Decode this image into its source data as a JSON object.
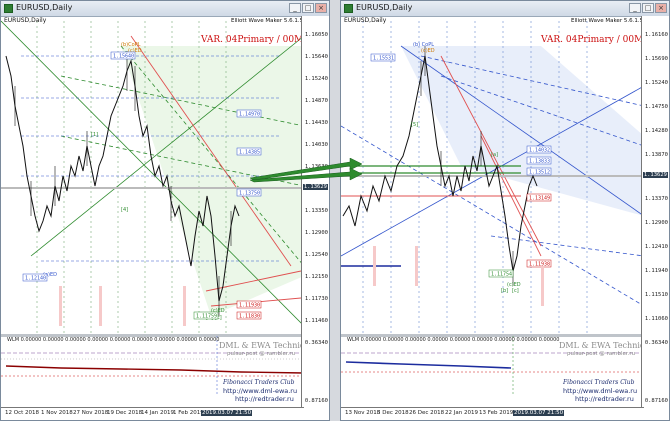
{
  "left": {
    "title": "EURUSD,Daily",
    "chart_label": "EURUSD,Daily",
    "tool": "Elliott Wave Maker 5.6.1.5",
    "variant": "VAR. 04Primary / 00Minute",
    "price_labels": [
      "1.16050",
      "1.15640",
      "1.15240",
      "1.14870",
      "1.14430",
      "1.14030",
      "1.13630",
      "1.13350",
      "1.12900",
      "1.12540",
      "1.12150",
      "1.11730",
      "1.11460"
    ],
    "current_price": "1.13629",
    "price_boxes": [
      "1.15640",
      "1.14970",
      "1.14385",
      "1.13750",
      "1.12140",
      "1.11759",
      "1.11930",
      "1.11830"
    ],
    "dates": [
      "12 Oct 2018",
      "1 Nov 2018",
      "27 Nov 2018",
      "19 Dec 2018",
      "14 Jan 2019",
      "1 Feb 2019"
    ],
    "current_date": "2019.03.07 21:50",
    "indicator_label": "WLM 0.00000 0.00000 0.00000 0.00000 0.00000 0.00000 0.00000 0.00000 0.00000",
    "indicator_right": "0.36340",
    "indicator_bottom": "0.87160",
    "brand": "DML & EWA Technique",
    "brand_sub": "pulsar-post @ rambler.ru",
    "fib": "Fibonacci  Traders  Club",
    "url1": "http://www.dml-ewa.ru",
    "url2": "http://redtrader.ru",
    "wave_labels": [
      "(b)CoPL",
      "(c)ED",
      "[a]",
      "(a)ED",
      "(c)ED",
      "[b]",
      "[c]"
    ]
  },
  "right": {
    "title": "EURUSD,Daily",
    "chart_label": "EURUSD,Daily",
    "tool": "Elliott Wave Maker 5.6.1.5",
    "variant": "VAR. 04Primary / 00Minute",
    "price_labels": [
      "1.16160",
      "1.15690",
      "1.15240",
      "1.14750",
      "1.14280",
      "1.13870",
      "1.13370",
      "1.12900",
      "1.12410",
      "1.11940",
      "1.11510",
      "1.11060"
    ],
    "current_price": "1.13629",
    "price_boxes": [
      "1.15531",
      "1.14032",
      "1.13833",
      "1.13512",
      "1.13149",
      "1.11938",
      "1.11754"
    ],
    "dates": [
      "13 Nov 2018",
      "5 Dec 2018",
      "26 Dec 2018",
      "22 Jan 2019",
      "13 Feb 2019"
    ],
    "current_date": "2019.03.07 21:50",
    "indicator_label": "WLM 0.00000 0.00000 0.00000 0.00000 0.00000 0.00000 0.00000 0.00000 0.00000",
    "indicator_right": "0.36340",
    "indicator_bottom": "0.87160",
    "brand": "DML & EWA Technique",
    "brand_sub": "pulsar-post @ rambler.ru",
    "fib": "Fibonacci  Traders  Club",
    "url1": "http://www.dml-ewa.ru",
    "url2": "http://redtrader.ru",
    "wave_labels": [
      "(b)CoPL",
      "(c)ED",
      "[a]",
      "[b]",
      "(c)ED",
      "[c]"
    ]
  },
  "colors": {
    "bull": "#1a1a1a",
    "accent_red": "#cc1111",
    "green": "#2e8b2e",
    "blue": "#3355cc",
    "dark": "#2c3e50"
  }
}
